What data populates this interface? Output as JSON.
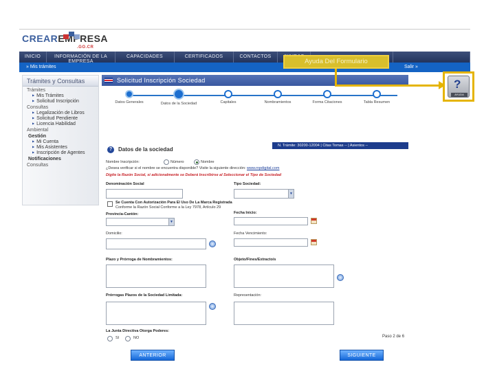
{
  "logo": {
    "part1": "CREAR",
    "part2": "EMPRESA",
    "sub": ".GO.CR"
  },
  "mainnav": [
    "INICIO",
    "INFORMACIÓN DE LA EMPRESA",
    "CAPACIDADES",
    "CERTIFICADOS",
    "CONTACTOS",
    "AYUDAS",
    "",
    ""
  ],
  "subnav": {
    "crumb": "» Mis trámites",
    "right": "Salir »"
  },
  "sidebar": {
    "title": "Trámites y Consultas",
    "items": [
      {
        "kind": "sec",
        "label": "Trámites"
      },
      {
        "kind": "sub",
        "label": "Mis Trámites"
      },
      {
        "kind": "sub",
        "label": "Solicitud Inscripción"
      },
      {
        "kind": "sec",
        "label": "Consultas"
      },
      {
        "kind": "sub",
        "label": "Legalización de Libros"
      },
      {
        "kind": "sub",
        "label": "Solicitud Pendiente"
      },
      {
        "kind": "sub",
        "label": "Licencia Habilidad"
      },
      {
        "kind": "sec",
        "label": "Ambiental"
      },
      {
        "kind": "hdr",
        "label": "Gestión"
      },
      {
        "kind": "sub",
        "label": "Mi Cuenta"
      },
      {
        "kind": "sub",
        "label": "Mis Asistentes"
      },
      {
        "kind": "sub",
        "label": "Inscripción de Agentes"
      },
      {
        "kind": "hdr",
        "label": "Notificaciones"
      },
      {
        "kind": "sec",
        "label": "Consultas"
      }
    ]
  },
  "panel": {
    "title": "Solicitud Inscripción Sociedad"
  },
  "steps": [
    {
      "label": "Datos Generales",
      "state": "done"
    },
    {
      "label": "Datos de la Sociedad",
      "state": "current"
    },
    {
      "label": "Capitales",
      "state": "open"
    },
    {
      "label": "Nombramientos",
      "state": "open"
    },
    {
      "label": "Forma Citaciones",
      "state": "open"
    },
    {
      "label": "Tabla Resumen",
      "state": "open"
    }
  ],
  "tramite": "N. Trámite: 30200-12004  |  Citas Tomas  --  |  Asientos  --",
  "section": {
    "title": "Datos de la sociedad"
  },
  "form": {
    "nombre_label": "Nombre Inscripción:",
    "opt_numero": "Número",
    "opt_nombre": "Nombre",
    "link_line_pre": "¿Desea verificar si el nombre se encuentra disponible? Visite la siguiente dirección: ",
    "link_text": "www.rnpdigital.com",
    "red_note": "Digite la Razón Social, si adicionalmente se Deberá Inscribirse al Seleccionar el Tipo de Sociedad",
    "denominacion_label": "Denominación Social",
    "tipo_label": "Tipo Sociedad:",
    "check_line1": "Se Cuenta Con Autorización Para El Uso De La Marca Registrada",
    "check_line2": "Conforme la Razón Social Conforme a la Ley 7978, Artículo 29",
    "provincia_label": "Provincia-Cantón:",
    "fecha_inicio_label": "Fecha Inicio:",
    "domicilio_label": "Domicilio:",
    "fecha_venc_label": "Fecha Vencimiento:",
    "plazo_label": "Plazo y Prórroga de Nombramientos:",
    "objeto_label": "Objeto/Fines/Extracto/s",
    "prorroga_label": "Prórrogas Plazos de la Sociedad Limitada:",
    "representacion_label": "Representación:",
    "junta_label": "La Junta Directiva Otorga Poderes:",
    "si": "SI",
    "no": "NO"
  },
  "buttons": {
    "prev": "ANTERIOR",
    "next": "SIGUIENTE"
  },
  "paso": "Paso 2 de 6",
  "callout": "Ayuda Del Formulario",
  "help": {
    "symbol": "?",
    "caption": "AYUDA"
  }
}
